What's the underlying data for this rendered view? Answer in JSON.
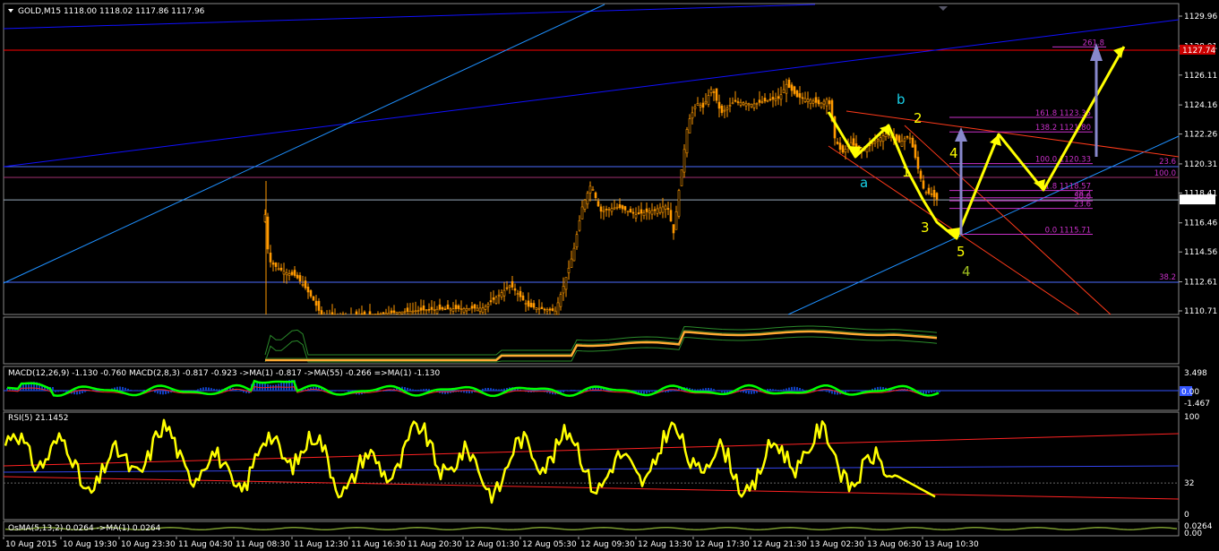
{
  "window": {
    "title": "GOLD,M15  1118.00 1118.02 1117.86 1117.96"
  },
  "indicators": {
    "macd": "MACD(12,26,9) -1.130 -0.760  MACD(2,8,3) -0.817 -0.923  ->MA(1) -0.817  ->MA(55) -0.266  =>MA(1) -1.130",
    "rsi": "RSI(5) 21.1452",
    "osma": "OsMA(5,13,2) 0.0264  ->MA(1) 0.0264"
  },
  "chart_data": {
    "type": "candlestick",
    "symbol": "GOLD",
    "timeframe": "M15",
    "ohlc_header": {
      "open": 1118.0,
      "high": 1118.02,
      "low": 1117.86,
      "close": 1117.96
    },
    "price_axis": {
      "ticks": [
        "1129.96",
        "1128.01",
        "1126.11",
        "1124.16",
        "1122.26",
        "1120.31",
        "1118.41",
        "1116.46",
        "1114.56",
        "1112.61",
        "1110.71"
      ],
      "current_price_tag": "1117.96",
      "red_level_tag": "1127.74"
    },
    "time_axis": [
      "10 Aug 2015",
      "10 Aug 19:30",
      "10 Aug 23:30",
      "11 Aug 04:30",
      "11 Aug 08:30",
      "11 Aug 12:30",
      "11 Aug 16:30",
      "11 Aug 20:30",
      "12 Aug 01:30",
      "12 Aug 05:30",
      "12 Aug 09:30",
      "12 Aug 13:30",
      "12 Aug 17:30",
      "12 Aug 21:30",
      "13 Aug 02:30",
      "13 Aug 06:30",
      "13 Aug 10:30"
    ],
    "close_path": [
      [
        0,
        1108
      ],
      [
        30,
        1108
      ],
      [
        60,
        1108.5
      ],
      [
        120,
        1108.3
      ],
      [
        180,
        1108.2
      ],
      [
        240,
        1108.4
      ],
      [
        296,
        1117
      ],
      [
        300,
        1114
      ],
      [
        310,
        1113.5
      ],
      [
        320,
        1113.2
      ],
      [
        330,
        1113
      ],
      [
        340,
        1112.3
      ],
      [
        350,
        1111.4
      ],
      [
        360,
        1110.3
      ],
      [
        420,
        1110.5
      ],
      [
        480,
        1110.8
      ],
      [
        540,
        1110.9
      ],
      [
        570,
        1112.4
      ],
      [
        590,
        1111.0
      ],
      [
        620,
        1110.7
      ],
      [
        630,
        1112.5
      ],
      [
        640,
        1114.5
      ],
      [
        650,
        1117.5
      ],
      [
        660,
        1119.0
      ],
      [
        670,
        1117.2
      ],
      [
        690,
        1117.5
      ],
      [
        710,
        1117.0
      ],
      [
        730,
        1117.3
      ],
      [
        745,
        1117.6
      ],
      [
        752,
        1115.8
      ],
      [
        760,
        1119.5
      ],
      [
        768,
        1123.0
      ],
      [
        778,
        1124.3
      ],
      [
        785,
        1124.0
      ],
      [
        795,
        1125.3
      ],
      [
        805,
        1123.6
      ],
      [
        820,
        1124.4
      ],
      [
        840,
        1124.2
      ],
      [
        860,
        1124.5
      ],
      [
        870,
        1124.6
      ],
      [
        878,
        1125.5
      ],
      [
        890,
        1124.7
      ],
      [
        905,
        1124.5
      ],
      [
        915,
        1124.2
      ],
      [
        925,
        1124.6
      ],
      [
        932,
        1122.0
      ],
      [
        940,
        1121.0
      ],
      [
        950,
        1121.7
      ],
      [
        960,
        1121.1
      ],
      [
        975,
        1121.7
      ],
      [
        990,
        1122.3
      ],
      [
        1005,
        1121.7
      ],
      [
        1015,
        1122.2
      ],
      [
        1020,
        1121.2
      ],
      [
        1025,
        1120.0
      ],
      [
        1032,
        1118.5
      ],
      [
        1040,
        1118.3
      ],
      [
        1046,
        1118.0
      ]
    ],
    "fib_levels": [
      {
        "label": "261.8",
        "price": 1127.95
      },
      {
        "label": "161.8 1123.35",
        "price": 1123.35
      },
      {
        "label": "138.2 1121.80",
        "price": 1122.4
      },
      {
        "label": "100.0 1120.33",
        "price": 1120.33
      },
      {
        "label": "61.8 1118.57",
        "price": 1118.57
      },
      {
        "label": "38.2",
        "price": 1118.1
      },
      {
        "label": "50.0",
        "price": 1117.9
      },
      {
        "label": "23.6",
        "price": 1117.4
      },
      {
        "label": "0.0 1115.71",
        "price": 1115.71
      }
    ],
    "right_fib_labels": [
      "23.6",
      "100.0",
      "38.2"
    ],
    "wave_labels": [
      {
        "text": "b",
        "color": "cyan"
      },
      {
        "text": "a",
        "color": "cyan"
      },
      {
        "text": "2",
        "color": "yellow"
      },
      {
        "text": "1",
        "color": "yellow"
      },
      {
        "text": "3",
        "color": "yellow"
      },
      {
        "text": "4",
        "color": "yellow"
      },
      {
        "text": "5",
        "color": "yellow"
      },
      {
        "text": "4",
        "color": "olive"
      }
    ],
    "macd_axis": [
      "3.498",
      "0.00",
      "-1.467"
    ],
    "rsi_axis": [
      "100",
      "32",
      "0"
    ],
    "osma_axis": [
      "0.0264",
      "0.00"
    ],
    "colors": {
      "bull": "#ff9900",
      "bear": "#ff9900",
      "wave": "#ffff00",
      "fib": "#c830c8",
      "trend_blue": "#1010ff",
      "trend_cyan": "#1e90ff",
      "red_level": "#ff0000",
      "macd_main": "#00ff00",
      "rsi": "#ffff00"
    }
  }
}
